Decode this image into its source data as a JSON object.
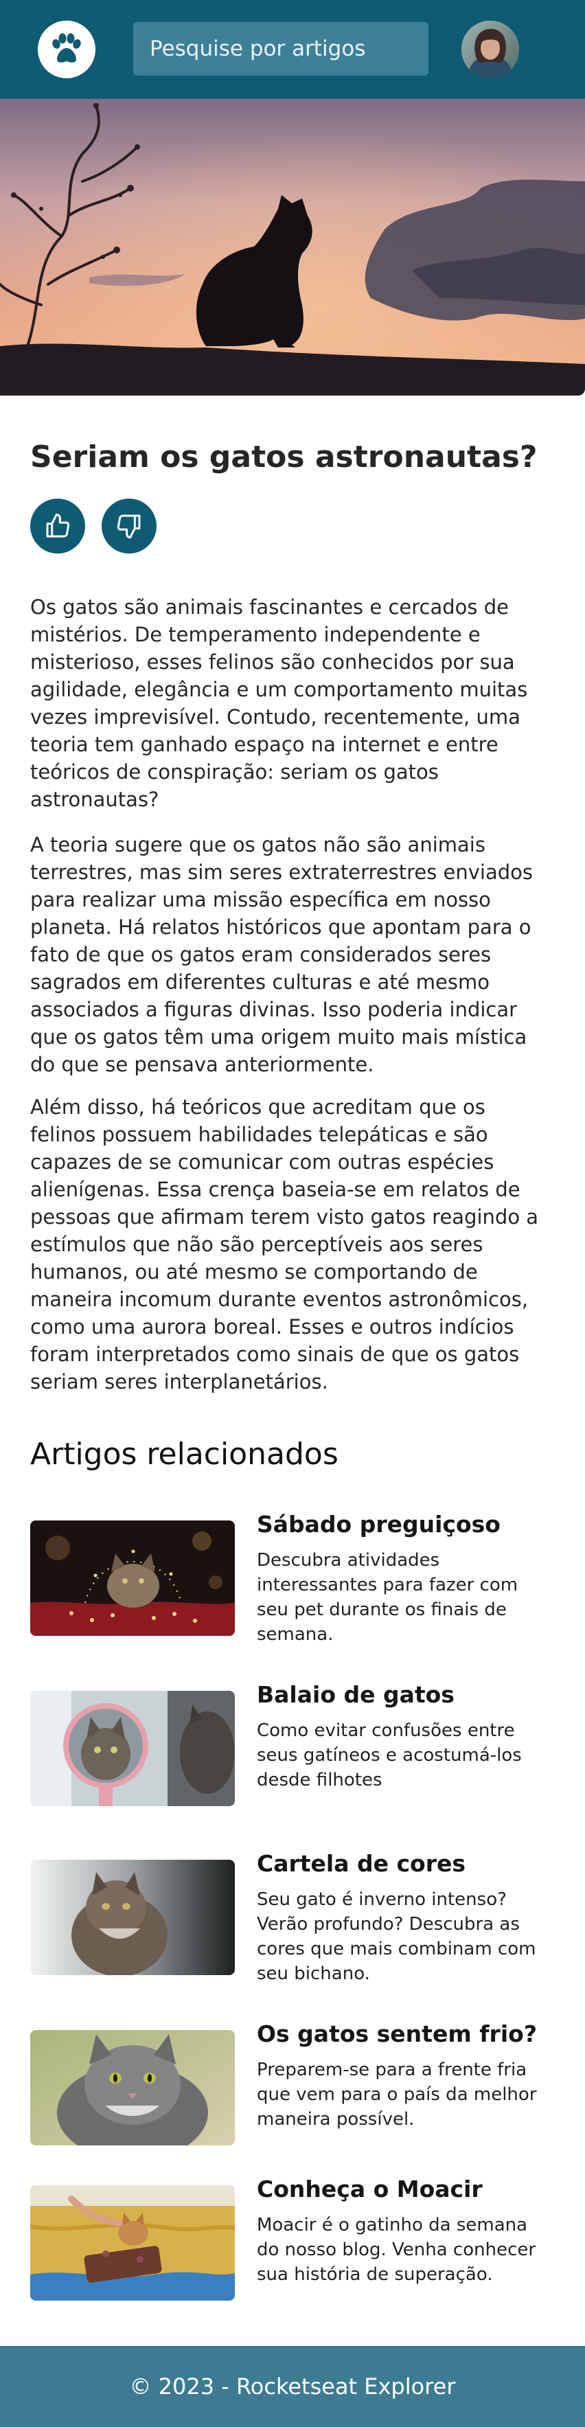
{
  "header": {
    "logo_icon": "paw-icon",
    "search_placeholder": "Pesquise por artigos",
    "avatar": "user-avatar"
  },
  "colors": {
    "primary": "#0e5b73",
    "search_bg": "#3d8098",
    "footer_bg": "#3c7b91"
  },
  "hero": {
    "image": "cat-silhouette-sunset"
  },
  "article": {
    "title": "Seriam os gatos astronautas?",
    "like_icon": "thumbs-up-icon",
    "dislike_icon": "thumbs-down-icon",
    "paragraphs": [
      "Os gatos são animais fascinantes e cercados de mistérios. De temperamento independente e misterioso, esses felinos são conhecidos por sua agilidade, elegância e um comportamento muitas vezes imprevisível. Contudo, recentemente, uma teoria tem ganhado espaço na internet e entre teóricos de conspiração: seriam os gatos astronautas?",
      "A teoria sugere que os gatos não são animais terrestres, mas sim seres extraterrestres enviados para realizar uma missão específica em nosso planeta. Há relatos históricos que apontam para o fato de que os gatos eram considerados seres sagrados em diferentes culturas e até mesmo associados a figuras divinas. Isso poderia indicar que os gatos têm uma origem muito mais mística do que se pensava anteriormente.",
      "Além disso, há teóricos que acreditam que os felinos possuem habilidades telepáticas e são capazes de se comunicar com outras espécies alienígenas. Essa crença baseia-se em relatos de pessoas que afirmam terem visto gatos reagindo a estímulos que não são perceptíveis aos seres humanos, ou até mesmo se comportando de maneira incomum durante eventos astronômicos, como uma aurora boreal. Esses e outros indícios foram interpretados como sinais de que os gatos seriam seres interplanetários."
    ]
  },
  "related": {
    "heading": "Artigos relacionados",
    "items": [
      {
        "title": "Sábado preguiçoso",
        "description": "Descubra atividades interessantes para fazer com seu pet durante os finais de semana.",
        "image": "cat-with-fairy-lights"
      },
      {
        "title": "Balaio de gatos",
        "description": "Como evitar confusões entre seus gatíneos e acostumá-los desde filhotes",
        "image": "cat-looking-in-mirror"
      },
      {
        "title": "Cartela de cores",
        "description": "Seu gato é inverno intenso? Verão profundo? Descubra as cores que mais combinam com seu bichano.",
        "image": "tabby-cat-by-window"
      },
      {
        "title": "Os gatos sentem frio?",
        "description": "Preparem-se para a frente fria que vem para o país da melhor maneira possível.",
        "image": "grey-cat-portrait"
      },
      {
        "title": "Conheça o Moacir",
        "description": "Moacir é o gatinho da semana do nosso blog. Venha conhecer sua história de superação.",
        "image": "kitten-on-yellow-blanket"
      }
    ]
  },
  "footer": {
    "text": "© 2023 - Rocketseat Explorer"
  }
}
